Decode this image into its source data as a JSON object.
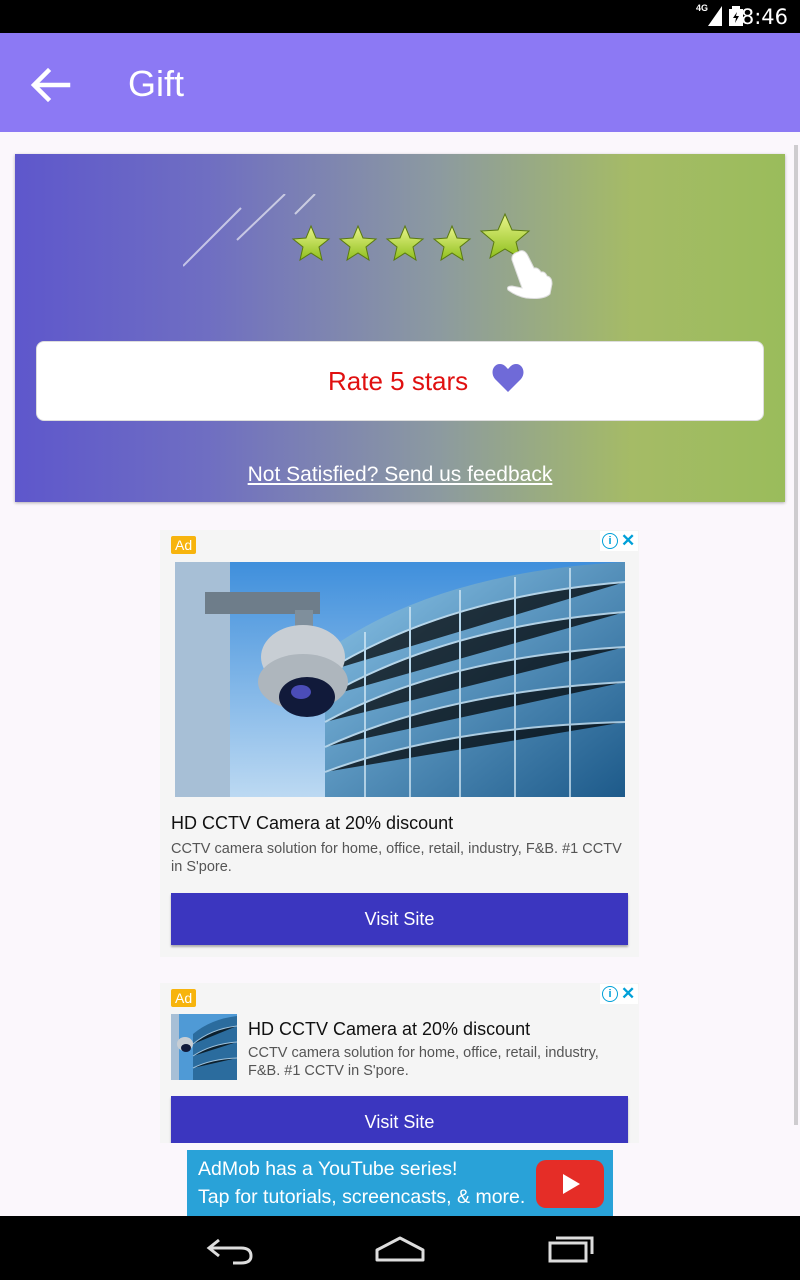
{
  "status_bar": {
    "time": "8:46",
    "network": "4G"
  },
  "app_bar": {
    "title": "Gift"
  },
  "rate_card": {
    "button_label": "Rate 5 stars",
    "feedback_link": "Not Satisfied? Send us feedback"
  },
  "ad1": {
    "badge": "Ad",
    "headline": "HD CCTV Camera at 20% discount",
    "body": "CCTV camera solution for home, office, retail, industry, F&B. #1 CCTV in S'pore.",
    "cta": "Visit Site"
  },
  "ad2": {
    "badge": "Ad",
    "headline": "HD CCTV Camera at 20% discount",
    "body": "CCTV camera solution for home, office, retail, industry, F&B. #1 CCTV in S'pore.",
    "cta": "Visit Site"
  },
  "banner": {
    "line1": "AdMob has a YouTube series!",
    "line2": "Tap for tutorials, screencasts, & more."
  },
  "colors": {
    "app_bar": "#8c79f4",
    "cta": "#3b36bf",
    "rate_text": "#e01010",
    "banner": "#29a2d8"
  }
}
